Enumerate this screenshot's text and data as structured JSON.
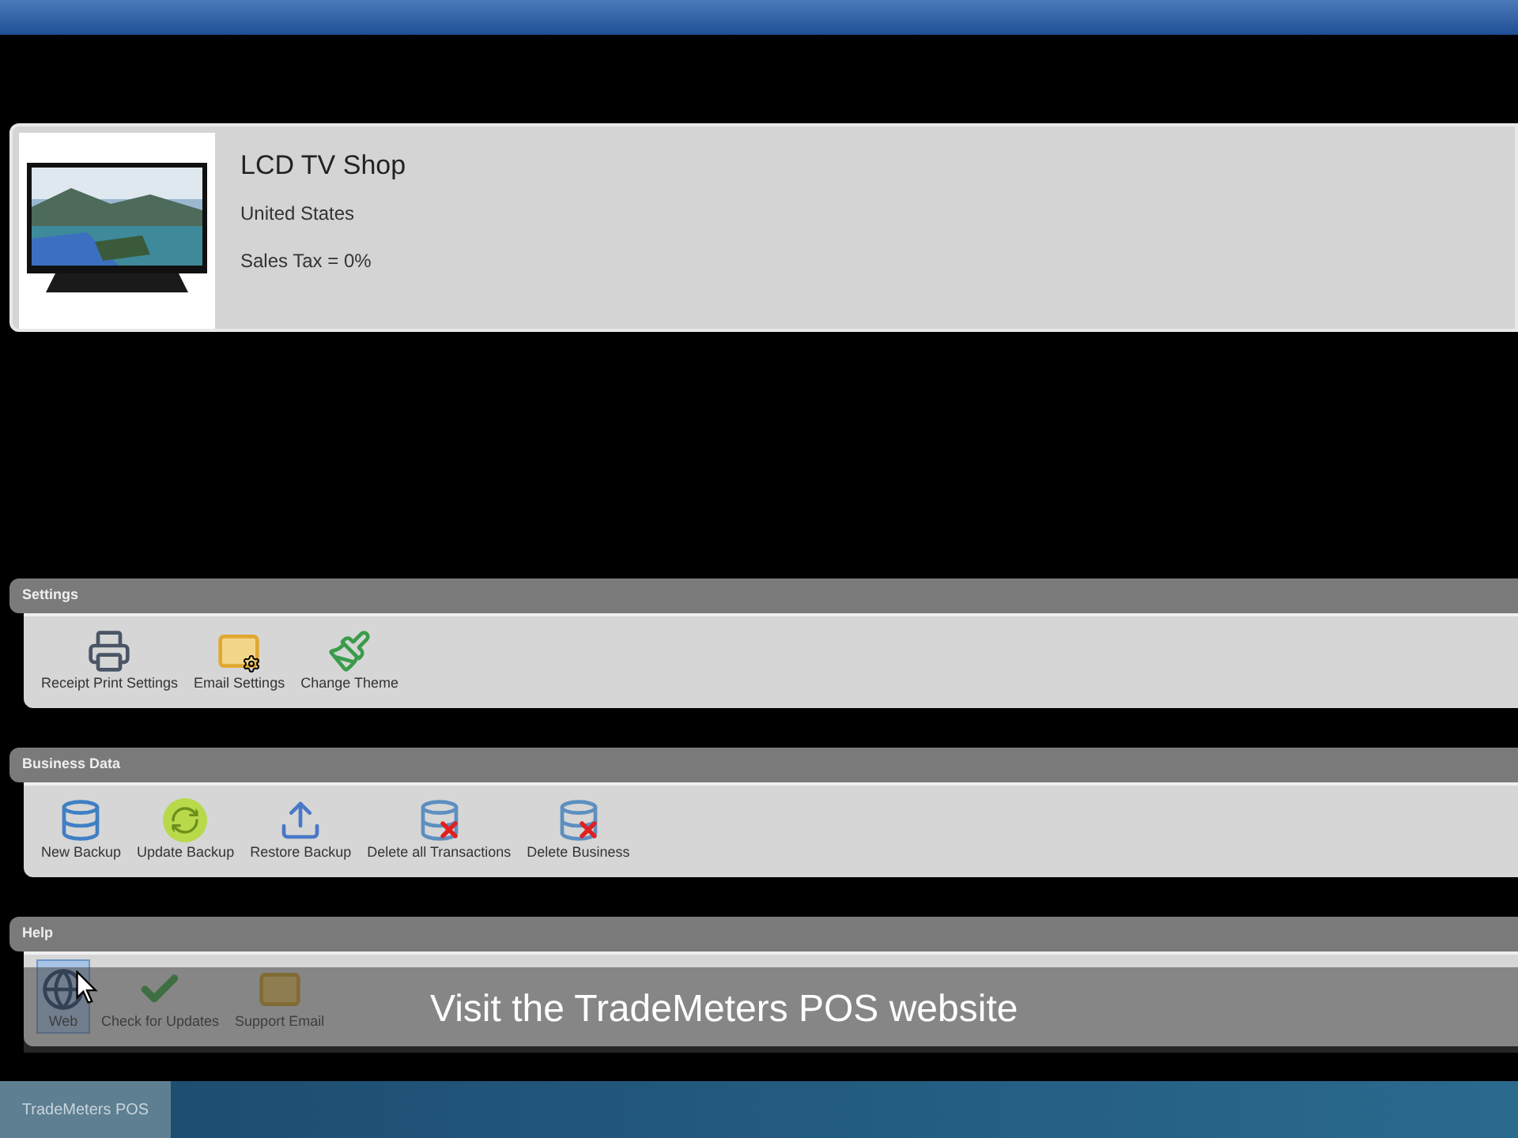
{
  "shop": {
    "name": "LCD TV Shop",
    "country": "United States",
    "tax": "Sales Tax = 0%"
  },
  "sections": [
    {
      "title": "Settings",
      "items": [
        {
          "label": "Receipt Print Settings",
          "kind": "printer",
          "selected": false
        },
        {
          "label": "Email Settings",
          "kind": "mail-gear",
          "selected": false
        },
        {
          "label": "Change Theme",
          "kind": "theme",
          "selected": false
        }
      ]
    },
    {
      "title": "Business Data",
      "items": [
        {
          "label": "New Backup",
          "kind": "backup",
          "selected": false
        },
        {
          "label": "Update Backup",
          "kind": "update",
          "selected": false
        },
        {
          "label": "Restore Backup",
          "kind": "restore",
          "selected": false
        },
        {
          "label": "Delete all Transactions",
          "kind": "delete",
          "selected": false
        },
        {
          "label": "Delete Business",
          "kind": "delete",
          "selected": false
        }
      ]
    },
    {
      "title": "Help",
      "items": [
        {
          "label": "Web",
          "kind": "globe",
          "selected": true
        },
        {
          "label": "Check for Updates",
          "kind": "check",
          "selected": false
        },
        {
          "label": "Support Email",
          "kind": "mail",
          "selected": false
        }
      ]
    }
  ],
  "caption": "Visit the TradeMeters POS website",
  "taskbar": {
    "app": "TradeMeters POS"
  }
}
